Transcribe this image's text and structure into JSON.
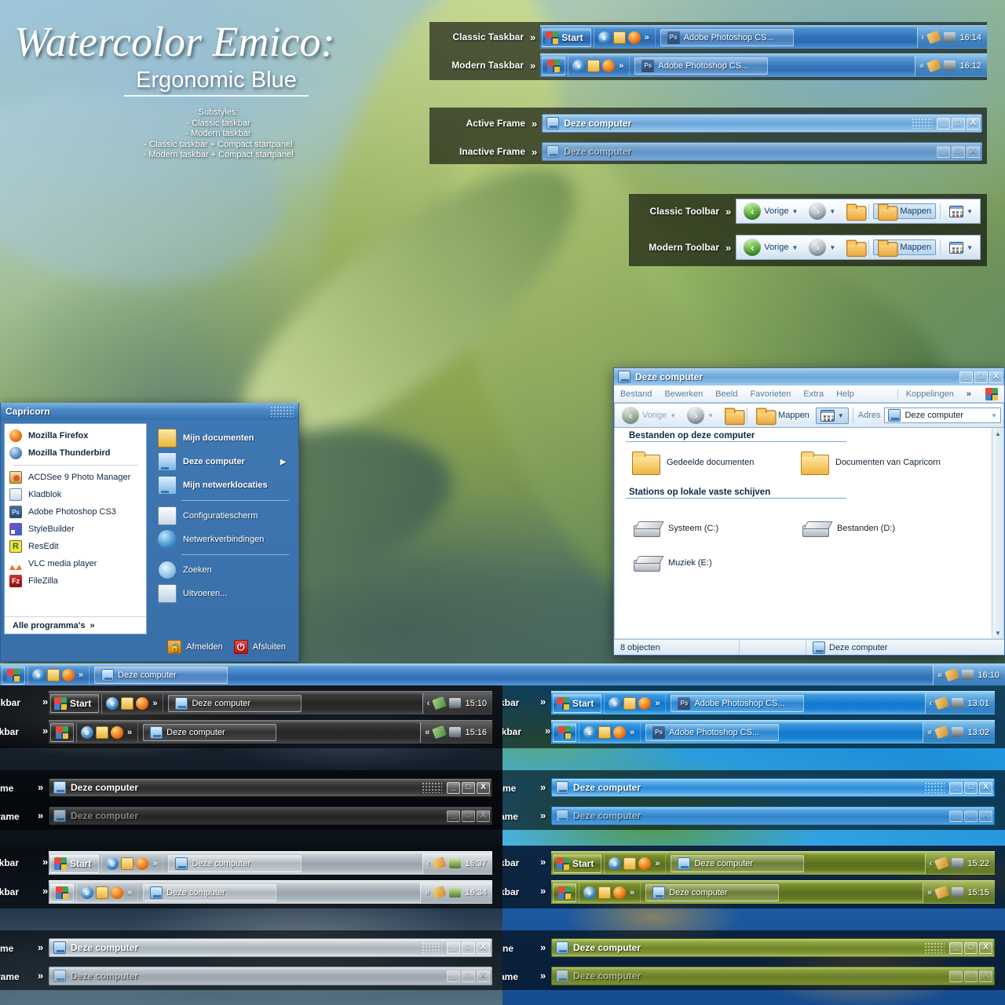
{
  "header": {
    "title": "Watercolor Emico:",
    "subtitle": "Ergonomic Blue",
    "substyles_label": "Substyles:",
    "substyles": [
      "- Classic taskbar",
      "- Modern taskbar",
      "- Classic taskbar + Compact startpanel",
      "- Modern taskbar + Compact startpanel"
    ]
  },
  "common": {
    "chevron": "»",
    "start_label": "Start",
    "window_title": "Deze computer",
    "photoshop_task": "Adobe Photoshop CS...",
    "btn_minimize": "_",
    "btn_maximize": "□",
    "btn_close": "X"
  },
  "showcase_taskbars": [
    {
      "label": "Classic Taskbar",
      "variant": "classic",
      "task": "Adobe Photoshop CS...",
      "task_icon": "photoshop-icon",
      "time": "16:14",
      "show_start_label": true
    },
    {
      "label": "Modern Taskbar",
      "variant": "modern",
      "task": "Adobe Photoshop CS...",
      "task_icon": "photoshop-icon",
      "time": "16:12",
      "show_start_label": false
    }
  ],
  "showcase_frames": [
    {
      "label": "Active Frame",
      "title": "Deze computer",
      "state": "active"
    },
    {
      "label": "Inactive Frame",
      "title": "Deze computer",
      "state": "inactive"
    }
  ],
  "showcase_toolbars": [
    {
      "label": "Classic Toolbar",
      "back": "Vorige",
      "folders": "Mappen"
    },
    {
      "label": "Modern Toolbar",
      "back": "Vorige",
      "folders": "Mappen"
    }
  ],
  "start_menu": {
    "user_name": "Capricorn",
    "pinned": [
      {
        "label": "Mozilla Firefox",
        "icon": "firefox-icon",
        "bold": true
      },
      {
        "label": "Mozilla Thunderbird",
        "icon": "thunderbird-icon",
        "bold": true
      }
    ],
    "recent": [
      {
        "label": "ACDSee 9 Photo Manager",
        "icon": "acdsee-icon"
      },
      {
        "label": "Kladblok",
        "icon": "notepad-icon"
      },
      {
        "label": "Adobe Photoshop CS3",
        "icon": "photoshop-icon"
      },
      {
        "label": "StyleBuilder",
        "icon": "stylebuilder-icon"
      },
      {
        "label": "ResEdit",
        "icon": "resedit-icon"
      },
      {
        "label": "VLC media player",
        "icon": "vlc-icon"
      },
      {
        "label": "FileZilla",
        "icon": "filezilla-icon"
      }
    ],
    "all_programs": "Alle programma's",
    "right_group1": [
      {
        "label": "Mijn documenten",
        "icon": "documents-icon",
        "bold": true,
        "submenu": false
      },
      {
        "label": "Deze computer",
        "icon": "computer-icon",
        "bold": true,
        "submenu": true
      },
      {
        "label": "Mijn netwerklocaties",
        "icon": "network-icon",
        "bold": true,
        "submenu": false
      }
    ],
    "right_group2": [
      {
        "label": "Configuratiescherm",
        "icon": "control-panel-icon",
        "bold": false,
        "submenu": false
      },
      {
        "label": "Netwerkverbindingen",
        "icon": "network-globe-icon",
        "bold": false,
        "submenu": false
      }
    ],
    "right_group3": [
      {
        "label": "Zoeken",
        "icon": "search-icon",
        "bold": false,
        "submenu": false
      },
      {
        "label": "Uitvoeren...",
        "icon": "run-icon",
        "bold": false,
        "submenu": false
      }
    ],
    "log_off": "Afmelden",
    "shut_down": "Afsluiten"
  },
  "explorer": {
    "title": "Deze computer",
    "menu": [
      "Bestand",
      "Bewerken",
      "Beeld",
      "Favorieten",
      "Extra",
      "Help"
    ],
    "links_label": "Koppelingen",
    "toolbar": {
      "back": "Vorige",
      "folders": "Mappen"
    },
    "address_label": "Adres",
    "address_value": "Deze computer",
    "group1_header": "Bestanden op deze computer",
    "group1_items": [
      {
        "label": "Gedeelde documenten",
        "icon": "folder-icon"
      },
      {
        "label": "Documenten van Capricorn",
        "icon": "folder-icon"
      }
    ],
    "group2_header": "Stations op lokale vaste schijven",
    "group2_items": [
      {
        "label": "Systeem (C:)",
        "icon": "drive-icon"
      },
      {
        "label": "Bestanden (D:)",
        "icon": "drive-icon"
      },
      {
        "label": "Muziek (E:)",
        "icon": "drive-icon"
      }
    ],
    "status_count": "8 objecten",
    "status_location": "Deze computer"
  },
  "desktop_taskbar": {
    "task": "Deze computer",
    "time": "16:10"
  },
  "variants": [
    {
      "id": "dark",
      "taskbars": [
        {
          "label": "skbar",
          "time": "15:10",
          "task": "Deze computer",
          "show_start_label": true
        },
        {
          "label": "skbar",
          "time": "15:16",
          "task": "Deze computer",
          "show_start_label": false
        }
      ],
      "frames": [
        {
          "label": "me",
          "title": "Deze computer",
          "state": "active"
        },
        {
          "label": "rame",
          "title": "Deze computer",
          "state": "inactive"
        }
      ]
    },
    {
      "id": "brightblue",
      "taskbars": [
        {
          "label": "kbar",
          "time": "13:01",
          "task": "Adobe Photoshop CS...",
          "show_start_label": true
        },
        {
          "label": "skbar",
          "time": "13:02",
          "task": "Adobe Photoshop CS...",
          "show_start_label": false
        }
      ],
      "frames": [
        {
          "label": "me",
          "title": "Deze computer",
          "state": "active"
        },
        {
          "label": "ame",
          "title": "Deze computer",
          "state": "inactive"
        }
      ]
    },
    {
      "id": "silver",
      "taskbars": [
        {
          "label": "skbar",
          "time": "16:37",
          "task": "Deze computer",
          "show_start_label": true
        },
        {
          "label": "skbar",
          "time": "16:34",
          "task": "Deze computer",
          "show_start_label": false
        }
      ],
      "frames": [
        {
          "label": "me",
          "title": "Deze computer",
          "state": "active"
        },
        {
          "label": "rame",
          "title": "Deze computer",
          "state": "inactive"
        }
      ]
    },
    {
      "id": "green",
      "taskbars": [
        {
          "label": "kbar",
          "time": "15:22",
          "task": "Deze computer",
          "show_start_label": true
        },
        {
          "label": "kbar",
          "time": "15:15",
          "task": "Deze computer",
          "show_start_label": false
        }
      ],
      "frames": [
        {
          "label": "ne",
          "title": "Deze computer",
          "state": "active"
        },
        {
          "label": "ame",
          "title": "Deze computer",
          "state": "inactive"
        }
      ]
    }
  ]
}
